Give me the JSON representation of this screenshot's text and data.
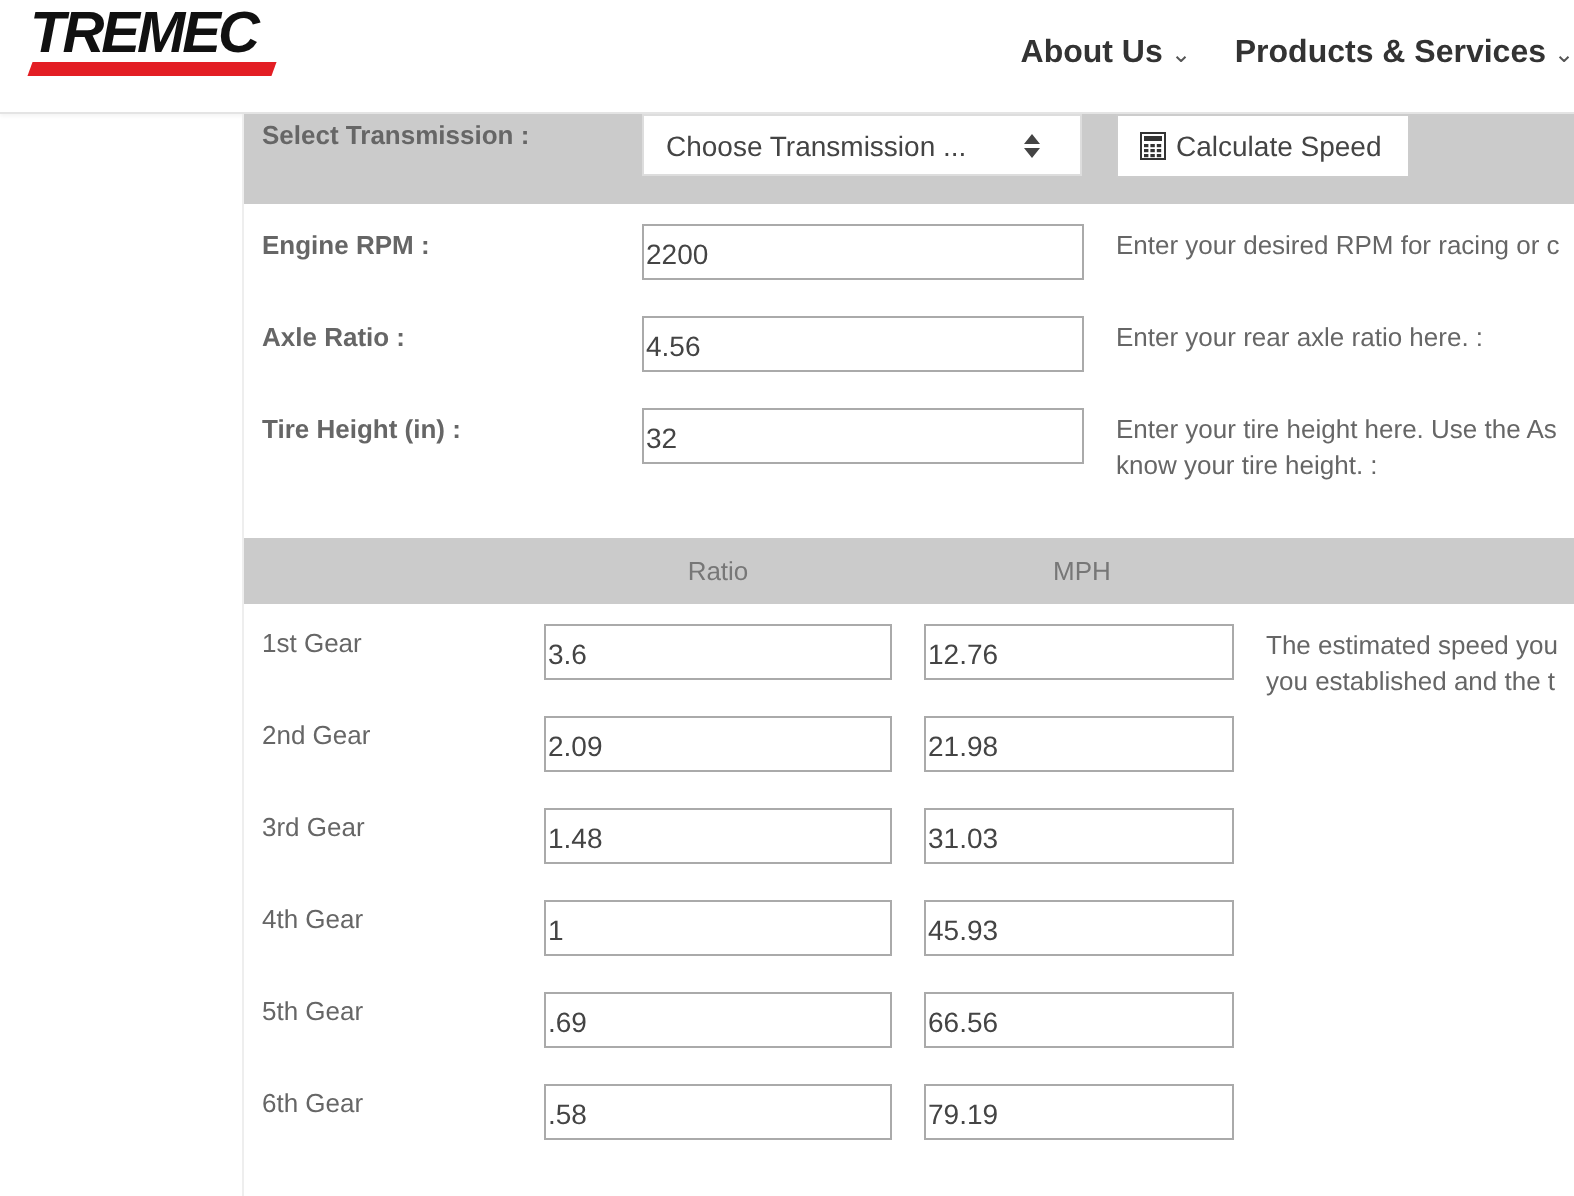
{
  "header": {
    "logo": "TREMEC",
    "nav": [
      {
        "label": "About Us",
        "caret": "⌄"
      },
      {
        "label": "Products & Services",
        "caret": "⌄"
      }
    ]
  },
  "transmission": {
    "label": "Select Transmission :",
    "select_value": "Choose Transmission ...",
    "button": "Calculate Speed"
  },
  "inputs": [
    {
      "label": "Engine RPM :",
      "value": "2200",
      "hint": [
        "Enter your desired RPM for racing or c"
      ]
    },
    {
      "label": "Axle Ratio :",
      "value": "4.56",
      "hint": [
        "Enter your rear axle ratio here. :"
      ]
    },
    {
      "label": "Tire Height (in) :",
      "value": "32",
      "hint": [
        "Enter your tire height here. Use the As",
        "know your tire height. :"
      ]
    }
  ],
  "gear_table": {
    "columns": [
      "Ratio",
      "MPH"
    ],
    "rows": [
      {
        "gear": "1st Gear",
        "ratio": "3.6",
        "mph": "12.76"
      },
      {
        "gear": "2nd Gear",
        "ratio": "2.09",
        "mph": "21.98"
      },
      {
        "gear": "3rd Gear",
        "ratio": "1.48",
        "mph": "31.03"
      },
      {
        "gear": "4th Gear",
        "ratio": "1",
        "mph": "45.93"
      },
      {
        "gear": "5th Gear",
        "ratio": ".69",
        "mph": "66.56"
      },
      {
        "gear": "6th Gear",
        "ratio": ".58",
        "mph": "79.19"
      }
    ],
    "note": [
      "The estimated speed you",
      "you established and the t"
    ]
  }
}
